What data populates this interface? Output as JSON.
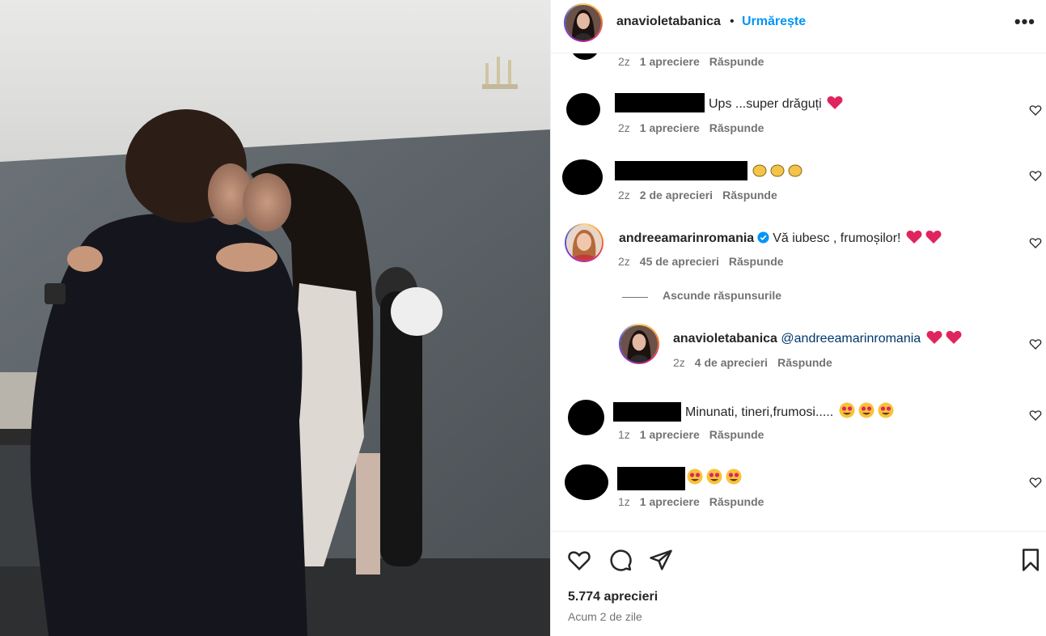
{
  "post": {
    "author": "anavioletabanica",
    "dot": "•",
    "follow_label": "Urmărește",
    "more_label": "•••",
    "likes_count": "5.774 aprecieri",
    "time_ago": "Acum 2 de zile"
  },
  "comments": [
    {
      "time": "2z",
      "likes": "1 apreciere",
      "reply": "Răspunde"
    },
    {
      "text": "Ups ...super drăguți",
      "time": "2z",
      "likes": "1 apreciere",
      "reply": "Răspunde"
    },
    {
      "text": "",
      "time": "2z",
      "likes": "2 de aprecieri",
      "reply": "Răspunde"
    },
    {
      "user": "andreeamarinromania",
      "verified": true,
      "text": "Vă iubesc , frumoșilor!",
      "time": "2z",
      "likes": "45 de aprecieri",
      "reply": "Răspunde",
      "hide_replies": "Ascunde răspunsurile",
      "reply_item": {
        "user": "anavioletabanica",
        "mention": "@andreeamarinromania",
        "time": "2z",
        "likes": "4 de aprecieri",
        "reply": "Răspunde"
      }
    },
    {
      "text": "Minunati, tineri,frumosi.....",
      "time": "1z",
      "likes": "1 apreciere",
      "reply": "Răspunde"
    },
    {
      "text": "",
      "time": "1z",
      "likes": "1 apreciere",
      "reply": "Răspunde"
    }
  ],
  "icons": {
    "like": "heart-icon",
    "comment": "comment-icon",
    "share": "share-icon",
    "save": "bookmark-icon",
    "verified": "verified-badge-icon"
  },
  "colors": {
    "link": "#0095f6",
    "mention": "#00376b",
    "muted": "#737373",
    "heart": "#e0245e"
  }
}
